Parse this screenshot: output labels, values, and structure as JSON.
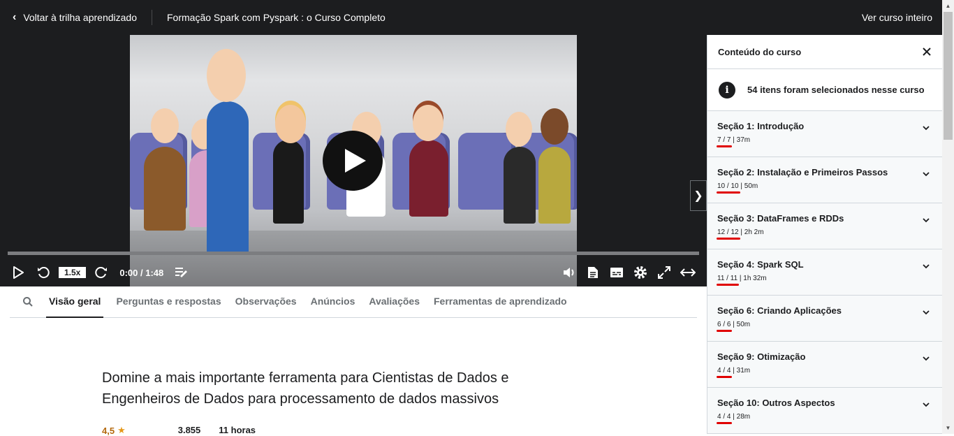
{
  "topbar": {
    "back_label": "Voltar à trilha aprendizado",
    "course_title": "Formação Spark com Pyspark : o Curso Completo",
    "full_course_label": "Ver curso inteiro"
  },
  "player": {
    "speed": "1.5x",
    "time": "0:00 / 1:48",
    "progress": 0
  },
  "tabs": {
    "items": [
      "Visão geral",
      "Perguntas e respostas",
      "Observações",
      "Anúncios",
      "Avaliações",
      "Ferramentas de aprendizado"
    ],
    "active": "Visão geral"
  },
  "overview": {
    "headline": "Domine a mais importante ferramenta para Cientistas de Dados e Engenheiros de Dados para processamento de dados massivos",
    "rating": "4,5",
    "students": "3.855",
    "duration": "11 horas"
  },
  "sidebar": {
    "title": "Conteúdo do curso",
    "info": "54 itens foram selecionados nesse curso",
    "sections": [
      {
        "title": "Seção 1: Introdução",
        "progress": "7 / 7",
        "duration": "| 37m"
      },
      {
        "title": "Seção 2: Instalação e Primeiros Passos",
        "progress": "10 / 10",
        "duration": "| 50m"
      },
      {
        "title": "Seção 3: DataFrames e RDDs",
        "progress": "12 / 12",
        "duration": "| 2h 2m"
      },
      {
        "title": "Seção 4: Spark SQL",
        "progress": "11 / 11",
        "duration": "| 1h 32m"
      },
      {
        "title": "Seção 6: Criando Aplicações",
        "progress": "6 / 6",
        "duration": "| 50m"
      },
      {
        "title": "Seção 9: Otimização",
        "progress": "4 / 4",
        "duration": "| 31m"
      },
      {
        "title": "Seção 10: Outros Aspectos",
        "progress": "4 / 4",
        "duration": "| 28m"
      }
    ]
  }
}
